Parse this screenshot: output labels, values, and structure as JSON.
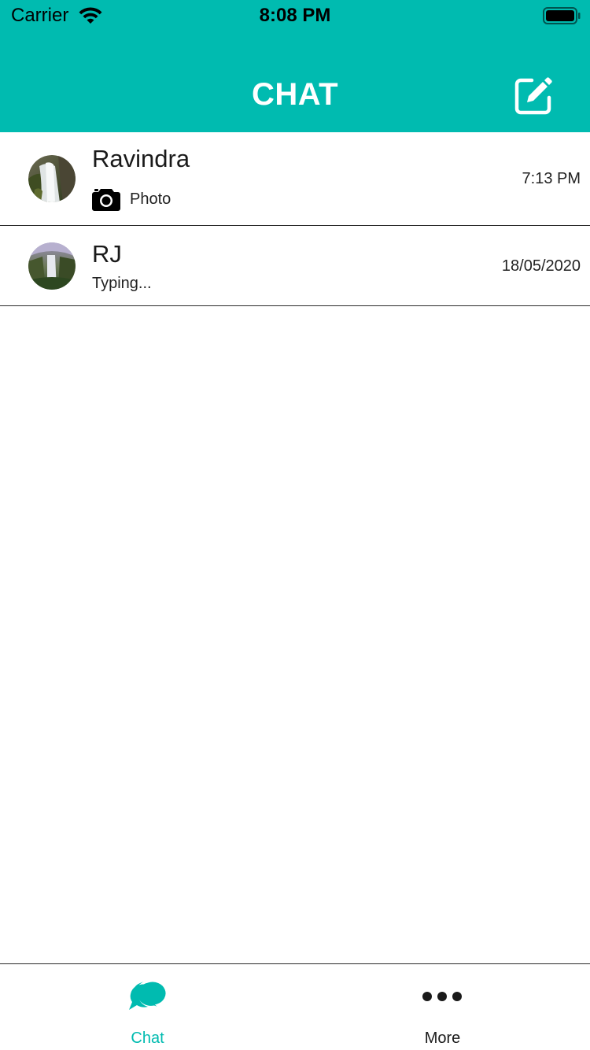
{
  "status_bar": {
    "carrier": "Carrier",
    "time": "8:08 PM",
    "wifi_icon": "wifi-icon",
    "battery_icon": "battery-icon"
  },
  "header": {
    "title": "CHAT",
    "compose_icon": "compose-icon",
    "background_color": "#00bbb0"
  },
  "chats": [
    {
      "name": "Ravindra",
      "preview_icon": "camera-icon",
      "preview": "Photo",
      "time": "7:13 PM",
      "avatar": "waterfall-avatar"
    },
    {
      "name": "RJ",
      "preview": "Typing...",
      "time": "18/05/2020",
      "avatar": "waterfall-avatar"
    }
  ],
  "tabbar": {
    "tabs": [
      {
        "label": "Chat",
        "icon": "chat-bubbles-icon",
        "active": true,
        "color": "#00bbb0"
      },
      {
        "label": "More",
        "icon": "more-dots-icon",
        "active": false,
        "color": "#1a1a1a"
      }
    ]
  }
}
